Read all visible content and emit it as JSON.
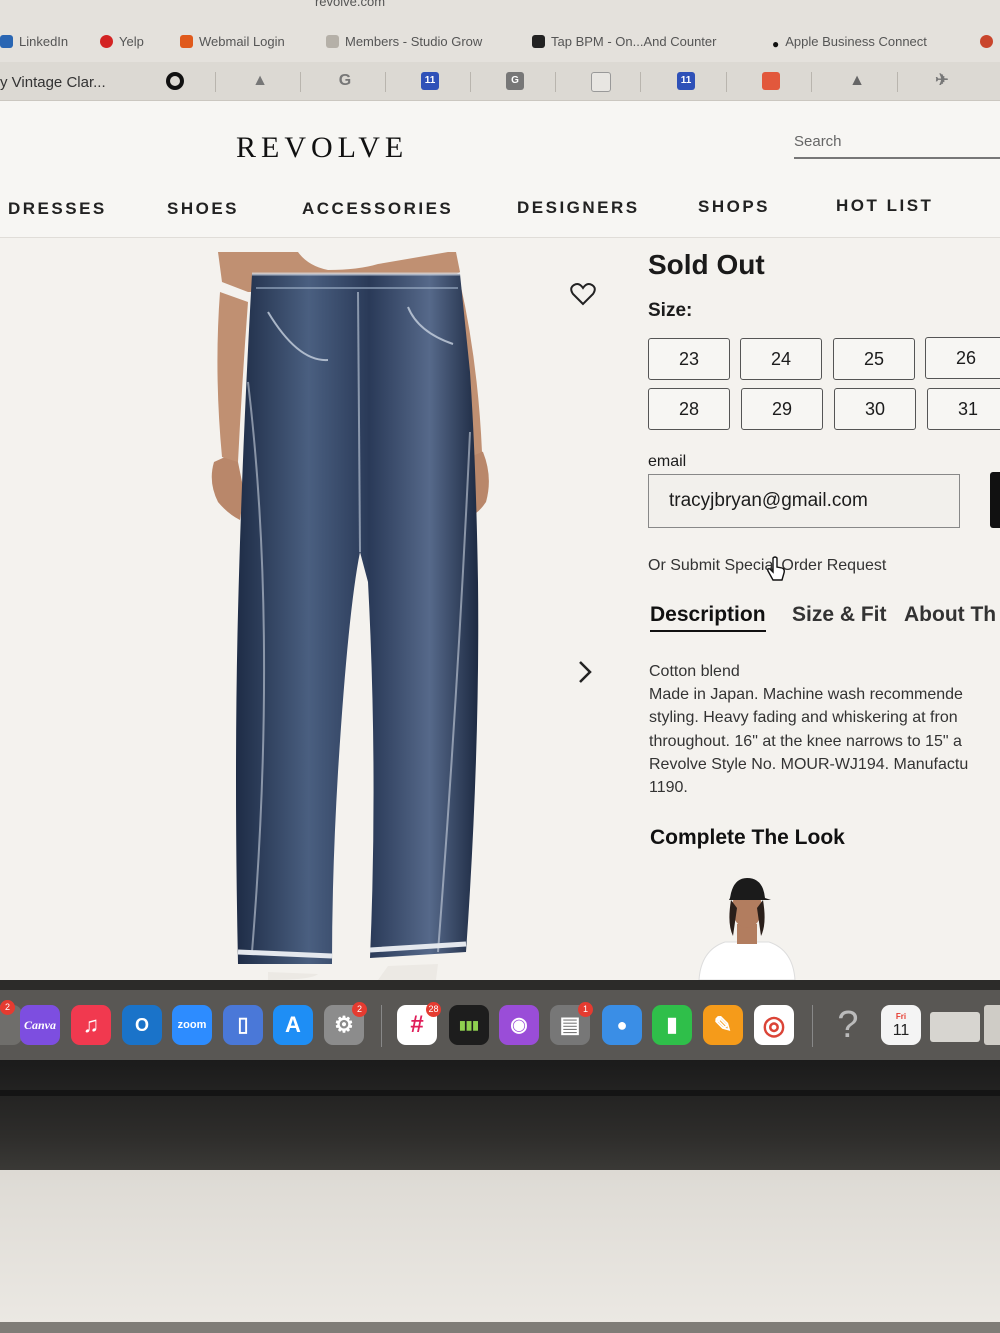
{
  "browser": {
    "url": "revolve.com",
    "bookmarks": [
      {
        "label": "LinkedIn",
        "color": "#2a66b3"
      },
      {
        "label": "Yelp",
        "color": "#d32323"
      },
      {
        "label": "Webmail Login",
        "color": "#e05a1c"
      },
      {
        "label": "Members - Studio Grow",
        "color": "#888888"
      },
      {
        "label": "Tap BPM - On...And Counter",
        "color": "#222222"
      },
      {
        "label": "Apple Business Connect",
        "color": "#111111"
      }
    ],
    "active_tab_title": "y Vintage Clar...",
    "tab_icons": [
      "circle-icon",
      "google-drive-icon",
      "google-icon",
      "calendar-icon",
      "grammarly-icon",
      "page-icon",
      "calendar-icon",
      "red-app-icon",
      "google-drive-icon",
      "bird-icon"
    ]
  },
  "site": {
    "logo": "REVOLVE",
    "search_placeholder": "Search",
    "nav": [
      "DRESSES",
      "SHOES",
      "ACCESSORIES",
      "DESIGNERS",
      "SHOPS",
      "HOT LIST"
    ]
  },
  "product": {
    "status": "Sold Out",
    "size_label": "Size:",
    "sizes": [
      "23",
      "24",
      "25",
      "26",
      "28",
      "29",
      "30",
      "31"
    ],
    "email_label": "email",
    "email_value": "tracyjbryan@gmail.com",
    "special_order": "Or Submit Special Order Request",
    "tabs": [
      "Description",
      "Size & Fit",
      "About Th"
    ],
    "description": [
      "Cotton blend",
      "Made in Japan. Machine wash recommende",
      "styling. Heavy fading and whiskering at fron",
      "throughout. 16\" at the knee narrows to 15\" a",
      "Revolve Style No. MOUR-WJ194. Manufactu",
      "1190."
    ],
    "complete_the_look": "Complete The Look"
  },
  "dock": {
    "apps": [
      {
        "name": "Canva",
        "label": "Canva",
        "color": "#7d4ee0"
      },
      {
        "name": "Music",
        "label": "♫",
        "color": "#f1394f"
      },
      {
        "name": "Outlook",
        "label": "O",
        "color": "#1a73c9"
      },
      {
        "name": "Zoom",
        "label": "zoom",
        "color": "#2d8cff"
      },
      {
        "name": "Phone",
        "label": "▯",
        "color": "#4a78d8"
      },
      {
        "name": "App Store",
        "label": "A",
        "color": "#1e8ef5"
      },
      {
        "name": "System Settings",
        "label": "⚙",
        "color": "#8c8c8c"
      },
      {
        "name": "Slack",
        "label": "#",
        "color": "#ffffff"
      },
      {
        "name": "Linktree",
        "label": "▮▮▮",
        "color": "#1d1d1d"
      },
      {
        "name": "Podcasts",
        "label": "◉",
        "color": "#9a4dd8"
      },
      {
        "name": "Printer",
        "label": "▤",
        "color": "#777777"
      },
      {
        "name": "Finder",
        "label": "●",
        "color": "#3a8ee6"
      },
      {
        "name": "Numbers",
        "label": "▮",
        "color": "#2fbf4a"
      },
      {
        "name": "Pages",
        "label": "✎",
        "color": "#f59b1a"
      },
      {
        "name": "Chrome",
        "label": "◎",
        "color": "#ffffff"
      }
    ],
    "badges": [
      "2",
      "2",
      "28",
      "1"
    ],
    "help": "?",
    "calendar": {
      "weekday": "Fri",
      "day": "11"
    }
  }
}
